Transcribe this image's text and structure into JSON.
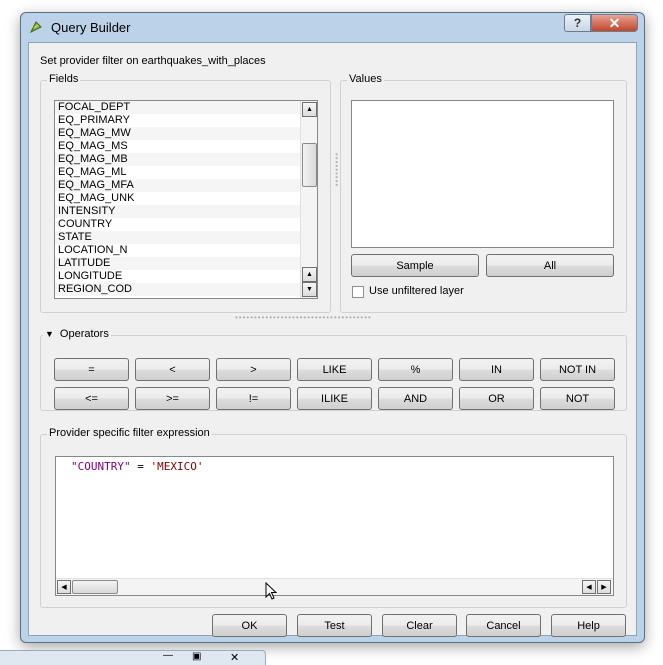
{
  "window": {
    "title": "Query Builder",
    "help_glyph": "?",
    "close_glyph": "✕"
  },
  "header": {
    "description": "Set provider filter on earthquakes_with_places"
  },
  "fields": {
    "title": "Fields",
    "items": [
      "FOCAL_DEPT",
      "EQ_PRIMARY",
      "EQ_MAG_MW",
      "EQ_MAG_MS",
      "EQ_MAG_MB",
      "EQ_MAG_ML",
      "EQ_MAG_MFA",
      "EQ_MAG_UNK",
      "INTENSITY",
      "COUNTRY",
      "STATE",
      "LOCATION_N",
      "LATITUDE",
      "LONGITUDE",
      "REGION_COD"
    ]
  },
  "values": {
    "title": "Values",
    "sample_label": "Sample",
    "all_label": "All",
    "unfiltered_label": "Use unfiltered layer",
    "unfiltered_checked": false
  },
  "operators": {
    "title": "Operators",
    "row1": [
      "=",
      "<",
      ">",
      "LIKE",
      "%",
      "IN",
      "NOT IN"
    ],
    "row2": [
      "<=",
      ">=",
      "!=",
      "ILIKE",
      "AND",
      "OR",
      "NOT"
    ]
  },
  "expression": {
    "title": "Provider specific filter expression",
    "field_part": "\"COUNTRY\"",
    "operator_part": " = ",
    "value_part": "'MEXICO'"
  },
  "buttons": {
    "ok": "OK",
    "test": "Test",
    "clear": "Clear",
    "cancel": "Cancel",
    "help": "Help"
  },
  "taskbar_fragment": {
    "minimize_glyph": "—",
    "restore_glyph": "▣",
    "close_glyph": "✕"
  },
  "colors": {
    "field_token": "#800080",
    "operator_token": "#000000",
    "value_token": "#800000"
  }
}
